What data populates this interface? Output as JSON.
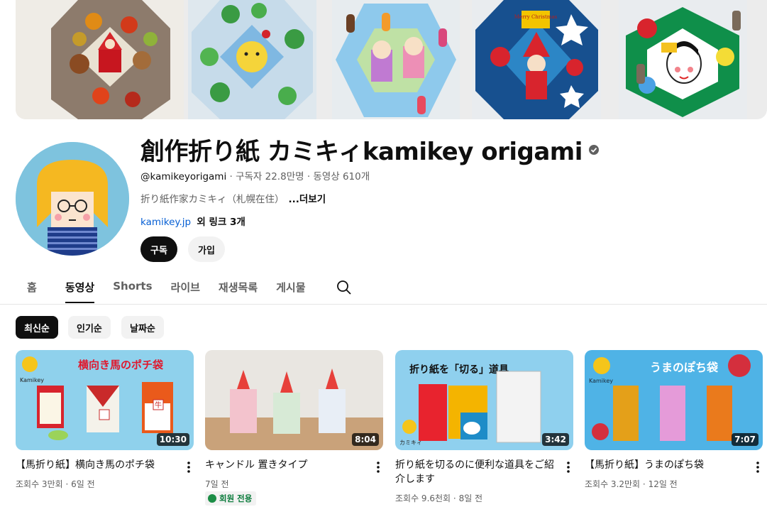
{
  "channel": {
    "name": "創作折り紙 カミキィkamikey origami",
    "handle": "@kamikeyorigami",
    "subscribers": "구독자 22.8만명",
    "video_count": "동영상 610개",
    "separator": " · ",
    "description": "折り紙作家カミキィ（札幌在住）",
    "more_label": "...더보기",
    "link_text": "kamikey.jp",
    "more_links": "외 링크 3개",
    "subscribe_label": "구독",
    "join_label": "가입"
  },
  "tabs": [
    {
      "label": "홈",
      "active": false
    },
    {
      "label": "동영상",
      "active": true
    },
    {
      "label": "Shorts",
      "active": false
    },
    {
      "label": "라이브",
      "active": false
    },
    {
      "label": "재생목록",
      "active": false
    },
    {
      "label": "게시물",
      "active": false
    }
  ],
  "chips": [
    {
      "label": "최신순",
      "active": true
    },
    {
      "label": "인기순",
      "active": false
    },
    {
      "label": "날짜순",
      "active": false
    }
  ],
  "videos": [
    {
      "title": "【馬折り紙】横向き馬のポチ袋",
      "duration": "10:30",
      "views": "조회수 3만회",
      "age": "6일 전",
      "thumb_text": "横向き馬のポチ袋",
      "thumb_logo": "Kamikey",
      "thumb_badge": "牛"
    },
    {
      "title": "キャンドル 置きタイプ",
      "duration": "8:04",
      "age": "7일 전",
      "member_badge": "회원 전용"
    },
    {
      "title": "折り紙を切るのに便利な道具をご紹介します",
      "duration": "3:42",
      "views": "조회수 9.6천회",
      "age": "8일 전",
      "thumb_text": "折り紙を「切る」道具",
      "thumb_logo": "カミキィ"
    },
    {
      "title": "【馬折り紙】うまのぽち袋",
      "duration": "7:07",
      "views": "조회수 3.2만회",
      "age": "12일 전",
      "thumb_text": "うまのぽち袋",
      "thumb_logo": "Kamikey"
    }
  ],
  "banner": {
    "tile4_text": "Merry Christmas"
  },
  "colors": {
    "link": "#065fd4",
    "dark": "#0f0f0f",
    "muted": "#606060",
    "chip_bg": "#f2f2f2",
    "member_green": "#0a7b3b"
  },
  "icons": {
    "verified": "verified-check-icon",
    "search": "search-icon",
    "menu": "more-vert-icon",
    "member": "member-star-icon"
  }
}
